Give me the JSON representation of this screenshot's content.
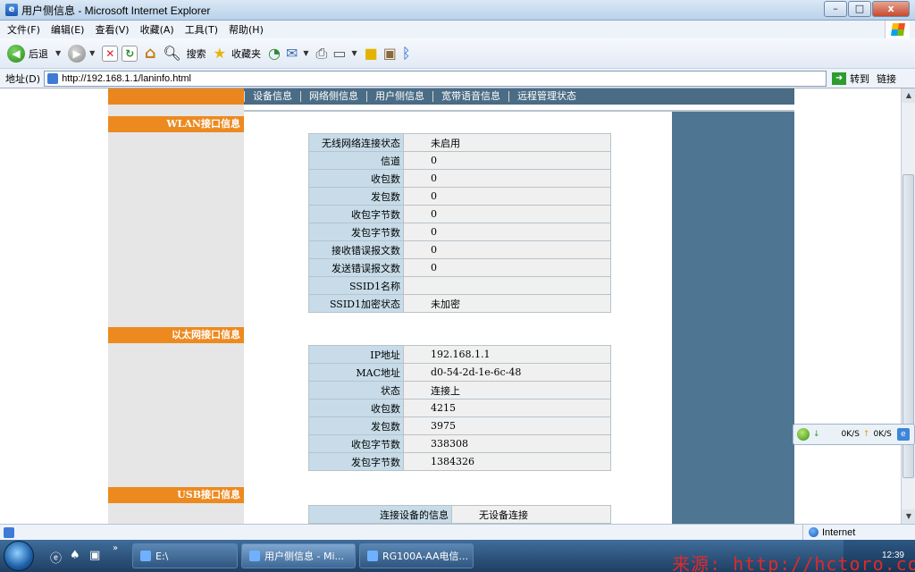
{
  "window": {
    "title": "用户侧信息 - Microsoft Internet Explorer",
    "controls": {
      "minimize": "–",
      "maximize": "□",
      "close": "x"
    }
  },
  "menu": [
    "文件(F)",
    "编辑(E)",
    "查看(V)",
    "收藏(A)",
    "工具(T)",
    "帮助(H)"
  ],
  "toolbar": {
    "back_label": "后退",
    "search_label": "搜索",
    "favorites_label": "收藏夹"
  },
  "address": {
    "label": "地址(D)",
    "url": "http://192.168.1.1/laninfo.html",
    "go_label": "转到",
    "links_label": "链接"
  },
  "nav": [
    "设备信息",
    "网络侧信息",
    "用户侧信息",
    "宽带语音信息",
    "远程管理状态"
  ],
  "sections": {
    "wlan": {
      "heading": "WLAN接口信息",
      "rows": [
        {
          "k": "无线网络连接状态",
          "v": "未启用"
        },
        {
          "k": "信道",
          "v": "0"
        },
        {
          "k": "收包数",
          "v": "0"
        },
        {
          "k": "发包数",
          "v": "0"
        },
        {
          "k": "收包字节数",
          "v": "0"
        },
        {
          "k": "发包字节数",
          "v": "0"
        },
        {
          "k": "接收错误报文数",
          "v": "0"
        },
        {
          "k": "发送错误报文数",
          "v": "0"
        },
        {
          "k": "SSID1名称",
          "v": ""
        },
        {
          "k": "SSID1加密状态",
          "v": "未加密"
        }
      ]
    },
    "ethernet": {
      "heading": "以太网接口信息",
      "rows": [
        {
          "k": "IP地址",
          "v": "192.168.1.1"
        },
        {
          "k": "MAC地址",
          "v": "d0-54-2d-1e-6c-48"
        },
        {
          "k": "状态",
          "v": "连接上"
        },
        {
          "k": "收包数",
          "v": "4215"
        },
        {
          "k": "发包数",
          "v": "3975"
        },
        {
          "k": "收包字节数",
          "v": "338308"
        },
        {
          "k": "发包字节数",
          "v": "1384326"
        }
      ]
    },
    "usb": {
      "heading": "USB接口信息",
      "rows": [
        {
          "k": "连接设备的信息",
          "v": "无设备连接"
        }
      ]
    }
  },
  "netwidget": {
    "down": "0K/S",
    "up": "0K/S"
  },
  "status": {
    "zone": "Internet"
  },
  "taskbar": {
    "tasks": [
      "E:\\",
      "用户侧信息 - Mi...",
      "RG100A-AA电信..."
    ],
    "clock": "12:39"
  },
  "watermark": "来源: http://hctoro.com"
}
